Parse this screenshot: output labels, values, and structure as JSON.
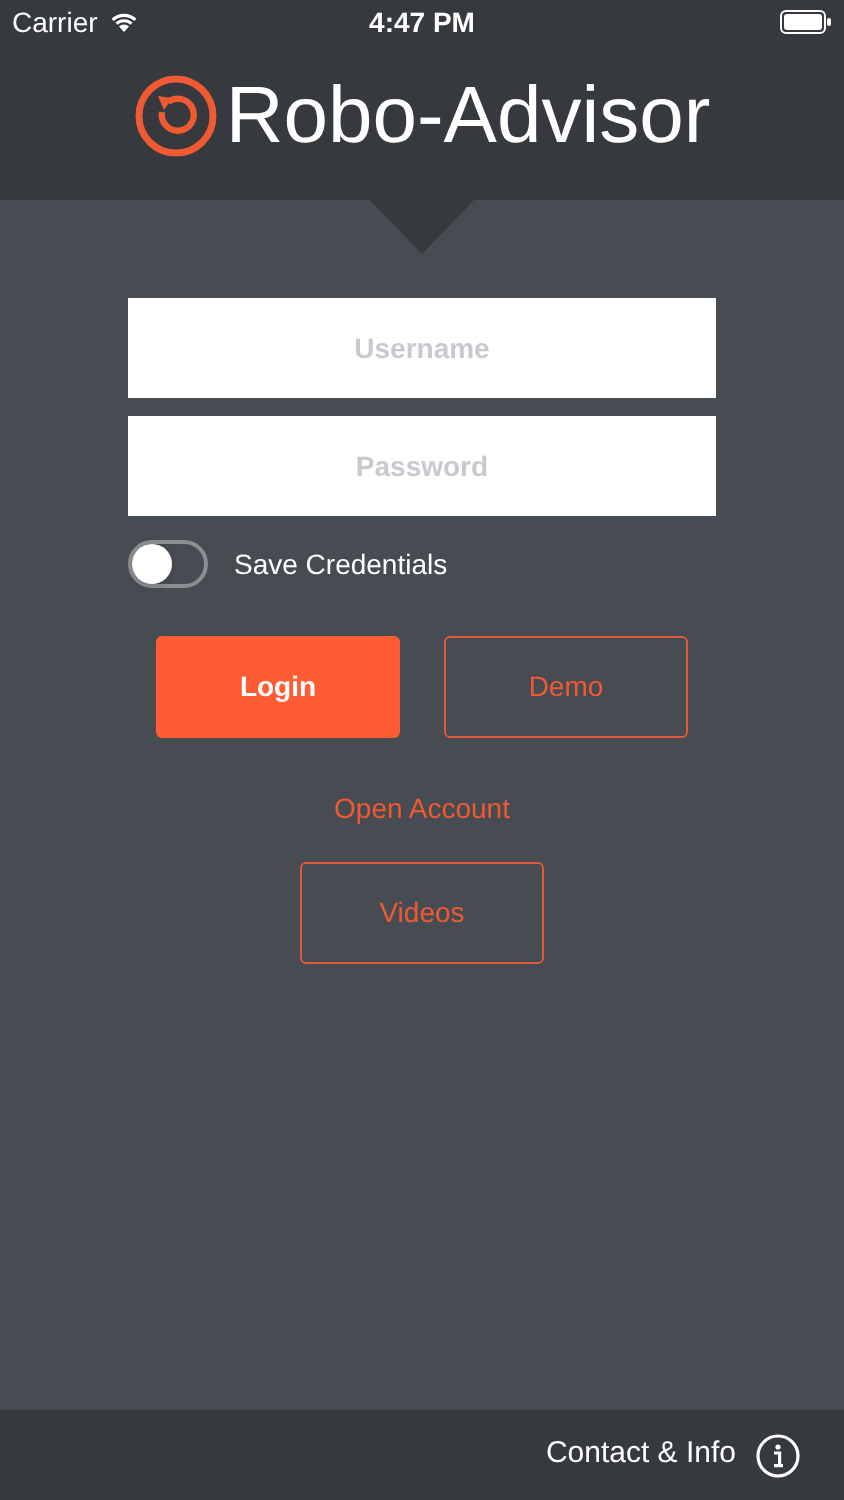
{
  "status_bar": {
    "carrier": "Carrier",
    "time": "4:47 PM"
  },
  "header": {
    "title": "Robo-Advisor"
  },
  "fields": [
    {
      "placeholder": "Username"
    },
    {
      "placeholder": "Password"
    }
  ],
  "save_credentials": {
    "label": "Save Credentials",
    "on": false
  },
  "buttons": [
    {
      "label": "Login",
      "kind": "primary"
    },
    {
      "label": "Demo",
      "kind": "outline"
    }
  ],
  "open_account": "Open Account",
  "videos_button": {
    "label": "Videos",
    "kind": "outline"
  },
  "footer": {
    "label": "Contact & Info"
  }
}
